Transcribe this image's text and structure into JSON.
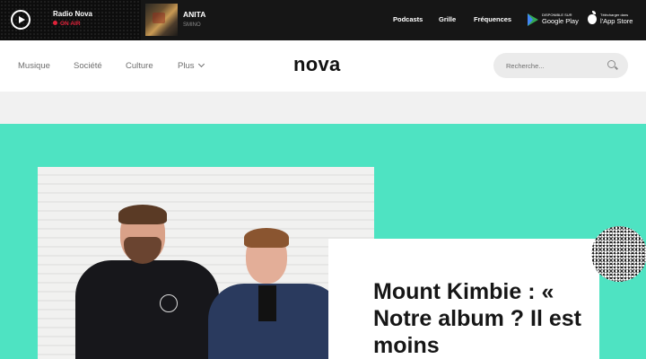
{
  "player": {
    "station": "Radio Nova",
    "on_air": "ON AIR",
    "track_title": "ANITA",
    "track_artist": "SMINO"
  },
  "top_nav": [
    "Podcasts",
    "Grille",
    "Fréquences"
  ],
  "stores": {
    "google": {
      "small": "DISPONIBLE SUR",
      "big": "Google Play"
    },
    "apple": {
      "small": "Télécharger dans",
      "big": "l'App Store"
    }
  },
  "header": {
    "nav": [
      "Musique",
      "Société",
      "Culture",
      "Plus"
    ],
    "logo": "nova",
    "search_placeholder": "Recherche..."
  },
  "hero": {
    "title": "Mount Kimbie : « Notre album ? Il est moins"
  },
  "colors": {
    "accent": "#4ee3c2",
    "on_air": "#e0233a",
    "player_bg": "#161616"
  }
}
